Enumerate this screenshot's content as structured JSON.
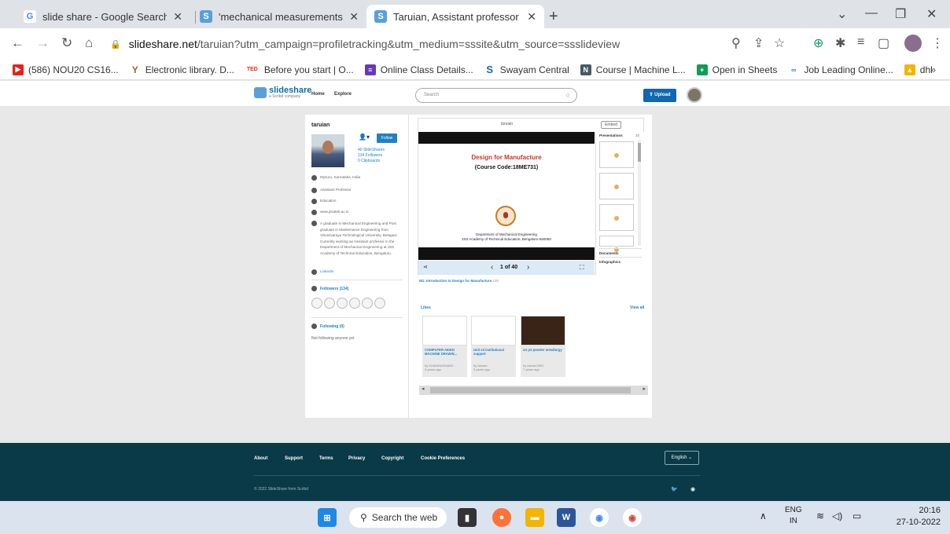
{
  "browser": {
    "tabs": [
      {
        "title": "slide share - Google Search",
        "favicon": "G",
        "color": "#4285f4"
      },
      {
        "title": "'mechanical measurements and i",
        "favicon": "S",
        "color": "#5aa0d6"
      },
      {
        "title": "Taruian, Assistant professor at Jss",
        "favicon": "S",
        "color": "#5aa0d6"
      }
    ],
    "address": {
      "host": "slideshare.net",
      "path": "/taruian?utm_campaign=profiletracking&utm_medium=sssite&utm_source=ssslideview"
    },
    "bookmarks": [
      {
        "label": "(586) NOU20 CS16...",
        "icon": "youtube-icon",
        "color": "#e62117"
      },
      {
        "label": "Electronic library. D...",
        "icon": "y-logo-icon",
        "color": "#8a6d3b"
      },
      {
        "label": "Before you start | O...",
        "icon": "ted-icon",
        "color": "#e62b1e"
      },
      {
        "label": "Online Class Details...",
        "icon": "forms-icon",
        "color": "#673ab7"
      },
      {
        "label": "Swayam Central",
        "icon": "s-logo-icon",
        "color": "#1565c0"
      },
      {
        "label": "Course | Machine L...",
        "icon": "nptel-icon",
        "color": "#455a64"
      },
      {
        "label": "Open in Sheets",
        "icon": "sheets-icon",
        "color": "#0f9d58"
      },
      {
        "label": "Job Leading Online...",
        "icon": "link-icon",
        "color": "#4a7bd0"
      },
      {
        "label": "dhl",
        "icon": "drive-icon",
        "color": "#f4b400"
      }
    ]
  },
  "slideshare": {
    "logo": "slideshare",
    "logo_sub": "a Scribd company",
    "nav": [
      "Home",
      "Explore"
    ],
    "search_placeholder": "Search",
    "upload_label": "Upload"
  },
  "profile": {
    "username": "taruian",
    "follow_label": "Follow",
    "stats": [
      "40 SlideShares",
      "134 Followers",
      "0 Clipboards"
    ],
    "location": "Mysuru, Karnataka, India",
    "job": "Assistant Professor",
    "industry": "Education",
    "website": "www.jssateb.ac.in",
    "bio": "A graduate in Mechanical Engineering and Post graduate in Maintenance Engineering from Visvesvaraya Technological University, Belagavi. Currently working as Assistant professor in the Department of Mechanical Engineering at JSS Academy of Technical Education, Bengaluru.",
    "linkedin": "LinkedIn",
    "followers_title": "Followers (134)",
    "following_title": "Following (0)",
    "following_empty": "Not following anyone yet"
  },
  "player": {
    "title": "taruian",
    "embed_label": "Embed",
    "slide": {
      "heading": "Design for Manufacture",
      "subheading": "(Course Code:18ME731)",
      "dept": "Department of Mechanical Engineering",
      "college": "JSS Academy of Technical Education, Bengaluru-560060"
    },
    "page_indicator": "1 of 40",
    "sidebar": {
      "presentations": "Presentations",
      "count": "33",
      "documents": "Documents",
      "infographics": "Infographics"
    },
    "current_title": "M1: Introduction to Design for Manufacture",
    "current_count": "100"
  },
  "likes": {
    "title": "Likes",
    "view_all": "View all",
    "items": [
      {
        "title": "COMPUTER AIDED MACHINE DRAWIN...",
        "by": "by KUMARASWAMI...",
        "age": "4 years ago"
      },
      {
        "title": "Unit v3 institutional support",
        "by": "by taruian",
        "age": "3 years ago"
      },
      {
        "title": "U1 p3 powder metallurgy",
        "by": "by taruian7691",
        "age": "7 years ago"
      }
    ]
  },
  "footer": {
    "links": [
      "About",
      "Support",
      "Terms",
      "Privacy",
      "Copyright",
      "Cookie Preferences"
    ],
    "language": "English",
    "copyright": "© 2022 SlideShare from Scribd"
  },
  "taskbar": {
    "search": "Search the web",
    "lang_top": "ENG",
    "lang_bottom": "IN",
    "time": "20:16",
    "date": "27-10-2022"
  }
}
